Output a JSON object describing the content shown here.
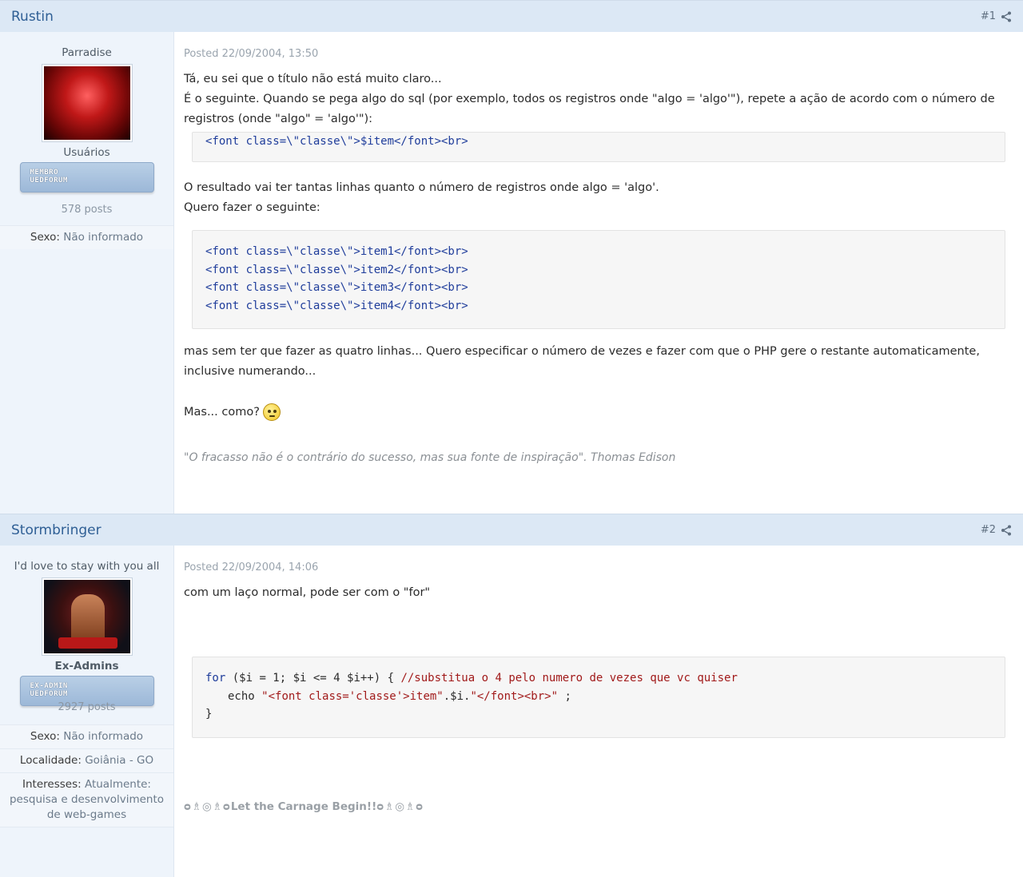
{
  "posts": [
    {
      "author": "Rustin",
      "number": "#1",
      "title": "Parradise",
      "group": "Usuários",
      "rank_line1": "MEMBRO",
      "rank_line2": "UEDFORUM",
      "post_count": "578 posts",
      "fields": [
        {
          "label": "Sexo:",
          "value": "Não informado"
        }
      ],
      "posted": "Posted 22/09/2004, 13:50",
      "text1": "Tá, eu sei que o título não está muito claro...",
      "text2": "É o seguinte. Quando se pega algo do sql (por exemplo, todos os registros onde \"algo = 'algo'\"), repete a ação de acordo com o número de registros (onde \"algo\" = 'algo'\"):",
      "code1": "<font class=\\\"classe\\\">$item</font><br>",
      "text3": "O resultado vai ter tantas linhas quanto o número de registros onde algo = 'algo'.",
      "text4": "Quero fazer o seguinte:",
      "code2": [
        "<font class=\\\"classe\\\">item1</font><br>",
        "<font class=\\\"classe\\\">item2</font><br>",
        "<font class=\\\"classe\\\">item3</font><br>",
        "<font class=\\\"classe\\\">item4</font><br>"
      ],
      "text5": "mas sem ter que fazer as quatro linhas... Quero especificar o número de vezes e fazer com que o PHP gere o restante automaticamente, inclusive numerando...",
      "text6": "Mas... como?",
      "signature": "\"O fracasso não é o contrário do sucesso, mas sua fonte de inspiração\". Thomas Edison"
    },
    {
      "author": "Stormbringer",
      "number": "#2",
      "title": "I'd love to stay with you all",
      "group": "Ex-Admins",
      "rank_line1": "EX-ADMIN",
      "rank_line2": "UEDFORUM",
      "post_count": "2927 posts",
      "fields": [
        {
          "label": "Sexo:",
          "value": "Não informado"
        },
        {
          "label": "Localidade:",
          "value": "Goiânia - GO"
        },
        {
          "label": "Interesses:",
          "value": "Atualmente: pesquisa e desenvolvimento de web-games"
        }
      ],
      "posted": "Posted 22/09/2004, 14:06",
      "text1": "com um laço normal, pode ser com o \"for\"",
      "code_for": "for",
      "code_cond": " ($i = 1; $i <= 4 $i++) { ",
      "code_comment": "//substitua o 4 pelo numero de vezes que vc quiser",
      "code_echo": "echo ",
      "code_str1": "\"<font class='classe'>item\"",
      "code_mid": ".$i.",
      "code_str2": "\"</font><br>\"",
      "code_end": " ;",
      "code_close": "}",
      "signature": "Let the Carnage Begin!!"
    }
  ],
  "colors": {
    "header_bg": "#dce8f5",
    "author_col_bg": "#eef4fb",
    "author_link": "#2f5f95"
  }
}
